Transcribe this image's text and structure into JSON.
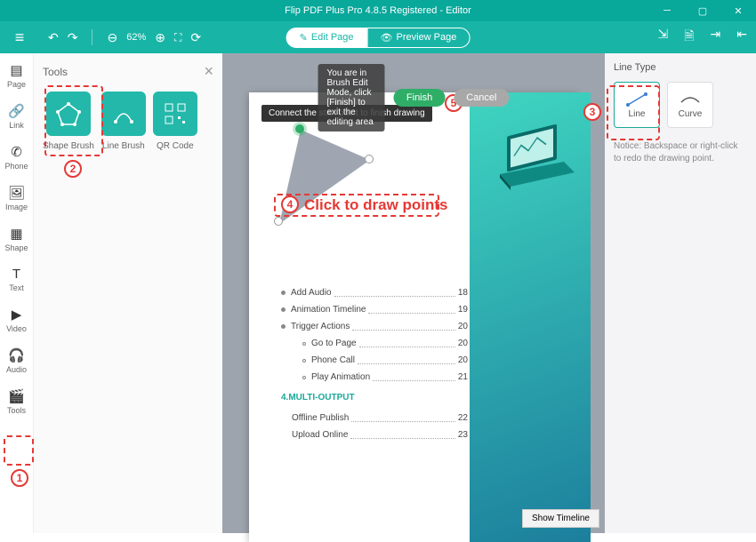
{
  "title": "Flip PDF Plus Pro 4.8.5 Registered - Editor",
  "toolbar": {
    "zoom": "62%",
    "edit_page": "Edit Page",
    "preview_page": "Preview Page"
  },
  "sidebar": {
    "items": [
      {
        "label": "Page"
      },
      {
        "label": "Link"
      },
      {
        "label": "Phone"
      },
      {
        "label": "Image"
      },
      {
        "label": "Shape"
      },
      {
        "label": "Text"
      },
      {
        "label": "Video"
      },
      {
        "label": "Audio"
      },
      {
        "label": "Tools"
      }
    ]
  },
  "tools_panel": {
    "title": "Tools",
    "cards": [
      {
        "label": "Shape Brush"
      },
      {
        "label": "Line Brush"
      },
      {
        "label": "QR Code"
      }
    ]
  },
  "brush_bar": {
    "msg": "You are in Brush Edit Mode, click [Finish] to exit the editing area",
    "finish": "Finish",
    "cancel": "Cancel"
  },
  "canvas": {
    "tooltip": "Connect the start point to finish drawing",
    "timeline_btn": "Show Timeline",
    "toc_heading": "4.MULTI-OUTPUT",
    "toc": [
      {
        "label": "Add Audio",
        "page": "18",
        "indent": 0
      },
      {
        "label": "Animation Timeline",
        "page": "19",
        "indent": 0
      },
      {
        "label": "Trigger Actions",
        "page": "20",
        "indent": 0
      },
      {
        "label": "Go to Page",
        "page": "20",
        "indent": 1
      },
      {
        "label": "Phone Call",
        "page": "20",
        "indent": 1
      },
      {
        "label": "Play Animation",
        "page": "21",
        "indent": 1
      },
      {
        "label": "Offline Publish",
        "page": "22",
        "indent": 0,
        "after_heading": true
      },
      {
        "label": "Upload Online",
        "page": "23",
        "indent": 0,
        "after_heading": true
      }
    ]
  },
  "line_type": {
    "title": "Line Type",
    "line": "Line",
    "curve": "Curve",
    "notice": "Notice: Backspace or right-click to redo the drawing point."
  },
  "annotations": {
    "n1": "1",
    "n2": "2",
    "n3": "3",
    "n4": "4",
    "n5": "5",
    "click_draw": "Click to draw points"
  }
}
